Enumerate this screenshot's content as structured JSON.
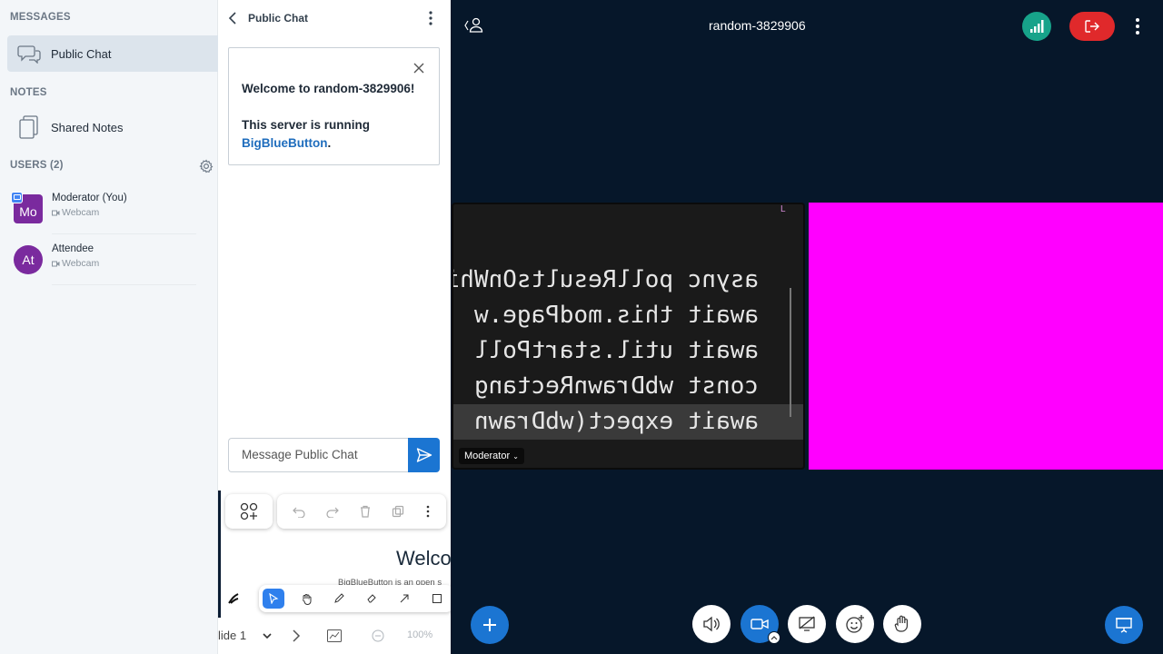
{
  "sidebar": {
    "messages_title": "MESSAGES",
    "public_chat_label": "Public Chat",
    "notes_title": "NOTES",
    "shared_notes_label": "Shared Notes",
    "users_title": "USERS (2)",
    "users": [
      {
        "initials": "Mo",
        "name": "Moderator (You)",
        "status": "Webcam"
      },
      {
        "initials": "At",
        "name": "Attendee",
        "status": "Webcam"
      }
    ]
  },
  "chat": {
    "title": "Public Chat",
    "welcome_prefix": "Welcome to ",
    "welcome_room": "random-3829906",
    "welcome_suffix": "!",
    "server_line": "This server is running",
    "server_link": "BigBlueButton",
    "server_period": ".",
    "input_placeholder": "Message Public Chat"
  },
  "whiteboard": {
    "slide_title": "Welco",
    "slide_subtitle": "BigBlueButton is an open s",
    "slide_label": "lide 1",
    "zoom": "100%"
  },
  "meeting": {
    "title": "random-3829906"
  },
  "video": {
    "presenter_name": "Moderator",
    "screen_code_lines": [
      "async pollResultsOnWhi",
      "await this.modPage.w",
      "await util.startPoll",
      "const wbDrawnRectang",
      "await expect(wbDrawn"
    ]
  },
  "colors": {
    "brand_blue": "#1b75d2",
    "leave_red": "#e0292b",
    "connection_green": "#17a38a",
    "webcam_placeholder": "#ff00ff",
    "background_dark": "#06172a"
  }
}
